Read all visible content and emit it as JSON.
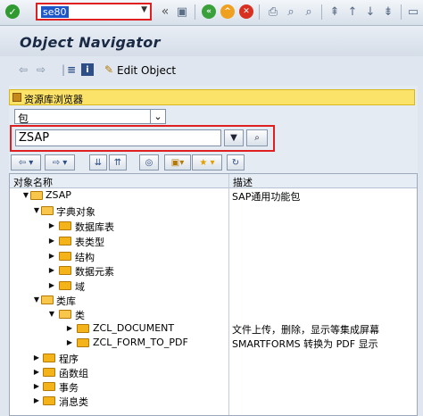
{
  "system_toolbar": {
    "command_field_value": "se80",
    "icons": [
      "ok-icon",
      "back-arrows-icon",
      "save-icon",
      "back-icon",
      "exit-icon",
      "cancel-icon",
      "print-icon",
      "find-icon",
      "find-next-icon",
      "first-page-icon",
      "prev-page-icon",
      "next-page-icon",
      "last-page-icon"
    ]
  },
  "title": "Object Navigator",
  "app_toolbar": {
    "edit_object_label": "Edit Object"
  },
  "repository_browser": {
    "header_label": "资源库浏览器",
    "object_type_value": "包",
    "object_name_value": "ZSAP"
  },
  "tree": {
    "col_name": "对象名称",
    "col_desc": "描述",
    "rows": [
      {
        "label": "ZSAP",
        "desc": "SAP通用功能包"
      },
      {
        "label": "字典对象",
        "desc": ""
      },
      {
        "label": "数据库表",
        "desc": ""
      },
      {
        "label": "表类型",
        "desc": ""
      },
      {
        "label": "结构",
        "desc": ""
      },
      {
        "label": "数据元素",
        "desc": ""
      },
      {
        "label": "域",
        "desc": ""
      },
      {
        "label": "类库",
        "desc": ""
      },
      {
        "label": "类",
        "desc": ""
      },
      {
        "label": "ZCL_DOCUMENT",
        "desc": "文件上传，删除，显示等集成屏幕"
      },
      {
        "label": "ZCL_FORM_TO_PDF",
        "desc": "SMARTFORMS 转换为 PDF 显示"
      },
      {
        "label": "程序",
        "desc": ""
      },
      {
        "label": "函数组",
        "desc": ""
      },
      {
        "label": "事务",
        "desc": ""
      },
      {
        "label": "消息类",
        "desc": ""
      }
    ]
  },
  "colors": {
    "highlight_border": "#e02020",
    "header_yellow": "#fbe36a",
    "folder": "#f5b31a"
  }
}
